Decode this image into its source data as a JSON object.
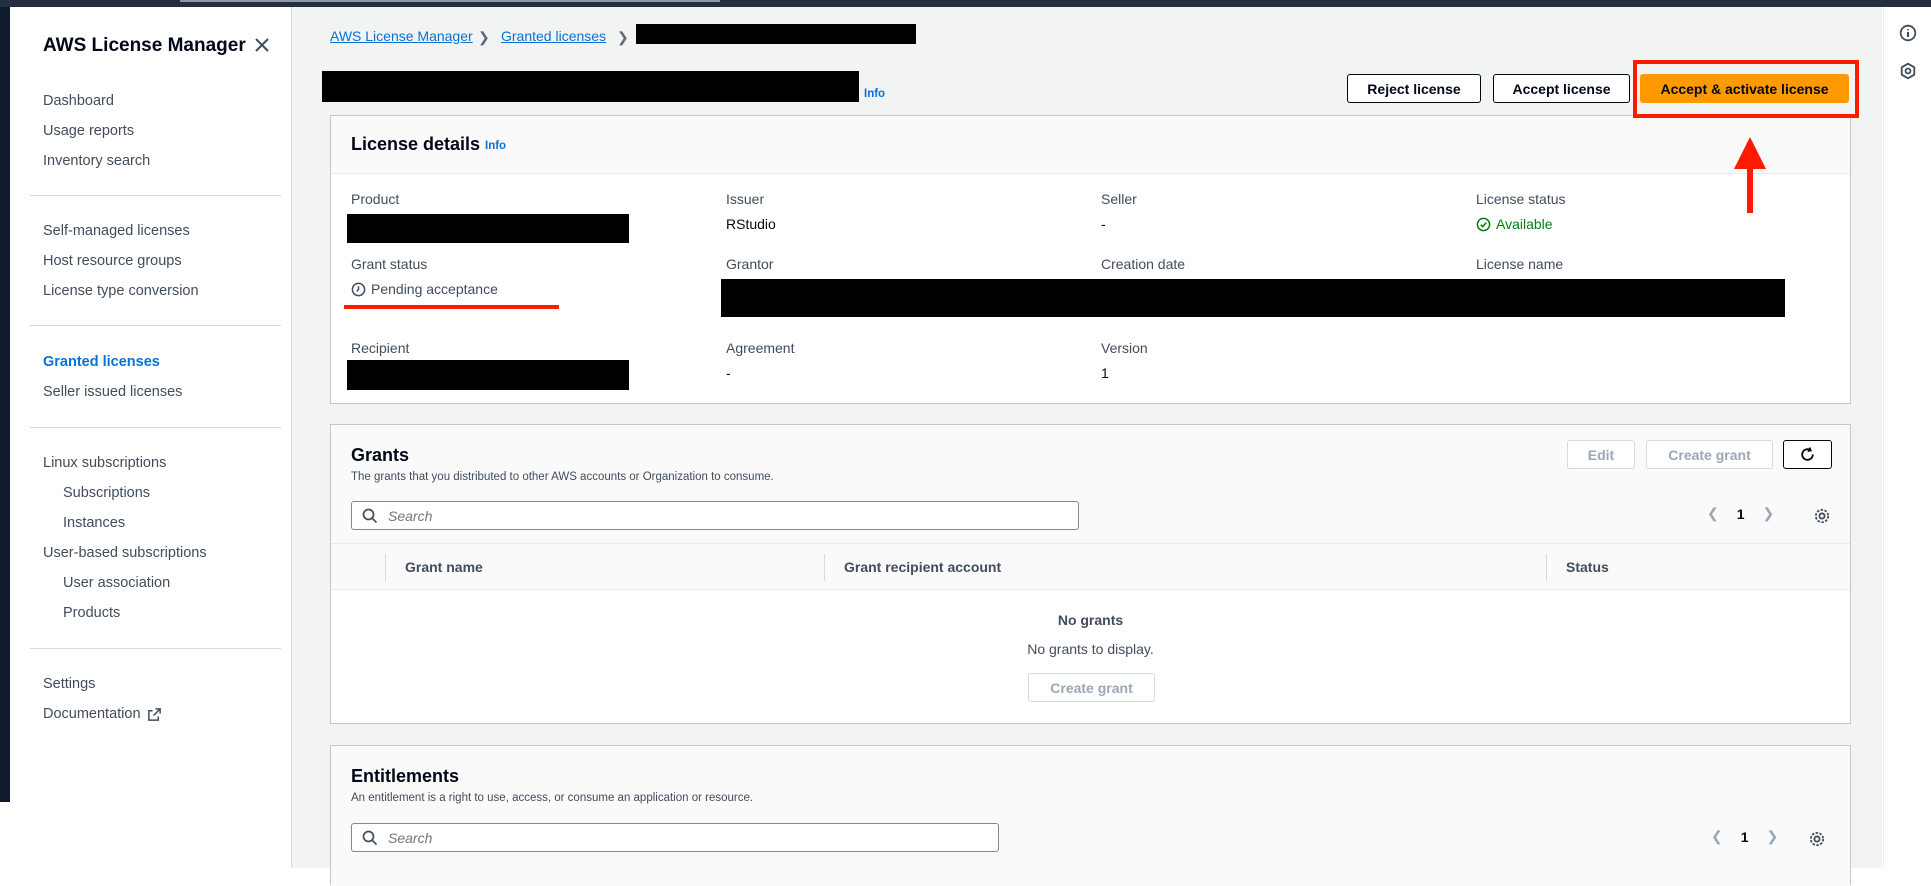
{
  "sidebar": {
    "title": "AWS License Manager",
    "items": [
      {
        "label": "Dashboard"
      },
      {
        "label": "Usage reports"
      },
      {
        "label": "Inventory search"
      },
      {
        "label": "Self-managed licenses"
      },
      {
        "label": "Host resource groups"
      },
      {
        "label": "License type conversion"
      },
      {
        "label": "Granted licenses"
      },
      {
        "label": "Seller issued licenses"
      },
      {
        "label": "Linux subscriptions"
      },
      {
        "label": "Subscriptions"
      },
      {
        "label": "Instances"
      },
      {
        "label": "User-based subscriptions"
      },
      {
        "label": "User association"
      },
      {
        "label": "Products"
      },
      {
        "label": "Settings"
      },
      {
        "label": "Documentation"
      }
    ]
  },
  "breadcrumb": {
    "home": "AWS License Manager",
    "parent": "Granted licenses"
  },
  "header": {
    "info": "Info",
    "reject_label": "Reject license",
    "accept_label": "Accept license",
    "accept_activate_label": "Accept & activate license"
  },
  "details": {
    "title": "License details",
    "info": "Info",
    "product_label": "Product",
    "issuer_label": "Issuer",
    "issuer_value": "RStudio",
    "seller_label": "Seller",
    "seller_value": "-",
    "license_status_label": "License status",
    "license_status_value": "Available",
    "grant_status_label": "Grant status",
    "grant_status_value": "Pending acceptance",
    "grantor_label": "Grantor",
    "creation_date_label": "Creation date",
    "license_name_label": "License name",
    "recipient_label": "Recipient",
    "agreement_label": "Agreement",
    "agreement_value": "-",
    "version_label": "Version",
    "version_value": "1"
  },
  "grants": {
    "title": "Grants",
    "description": "The grants that you distributed to other AWS accounts or Organization to consume.",
    "edit_label": "Edit",
    "create_grant_label": "Create grant",
    "search_placeholder": "Search",
    "page": "1",
    "columns": [
      "Grant name",
      "Grant recipient account",
      "Status"
    ],
    "empty_title": "No grants",
    "empty_desc": "No grants to display.",
    "empty_button": "Create grant"
  },
  "entitlements": {
    "title": "Entitlements",
    "description": "An entitlement is a right to use, access, or consume an application or resource.",
    "search_placeholder": "Search",
    "page": "1"
  },
  "colors": {
    "accent": "#0972d3",
    "primary": "#ff9900",
    "success": "#037f0c",
    "annotation": "#ff1a00"
  }
}
